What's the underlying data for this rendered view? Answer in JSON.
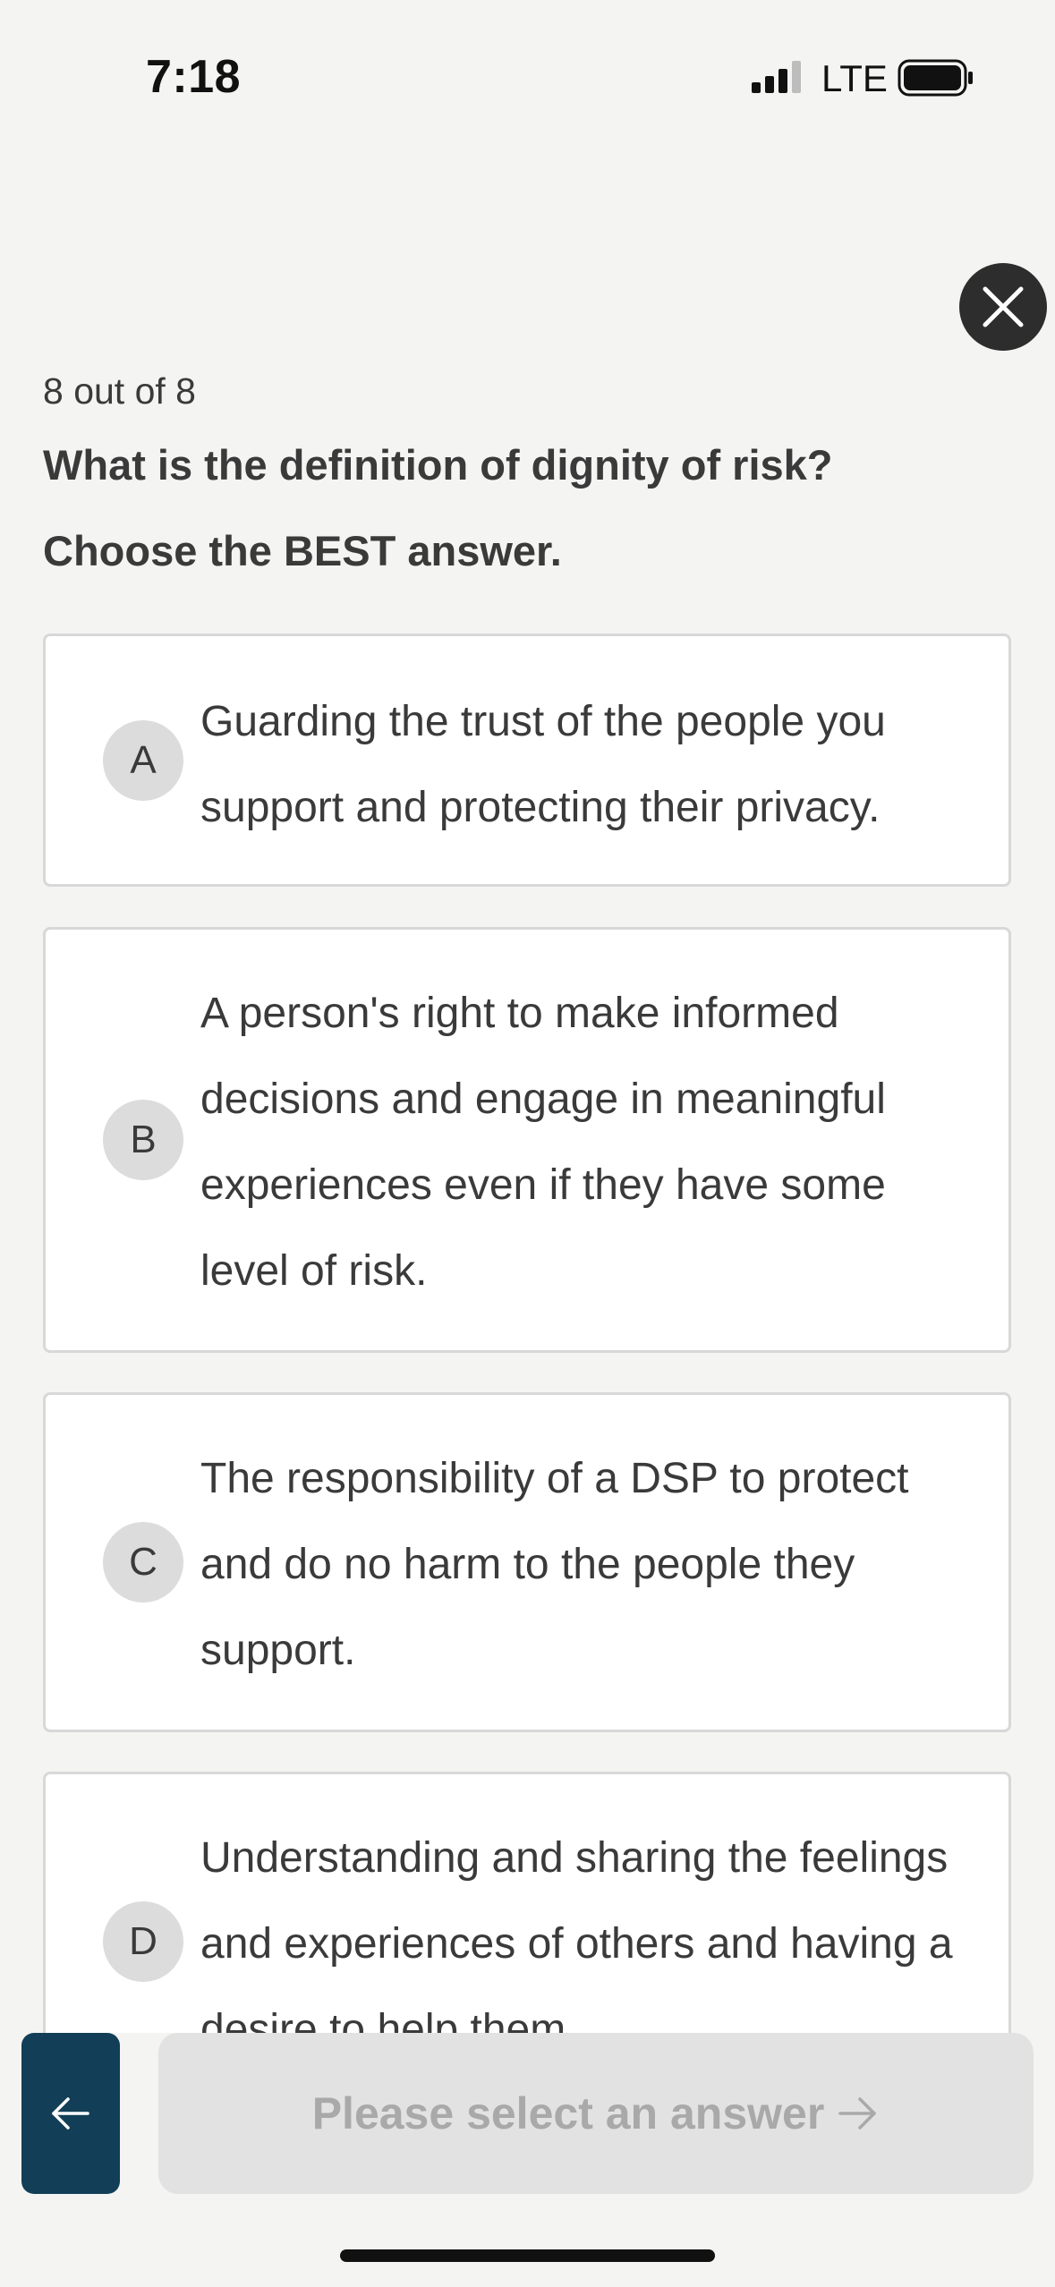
{
  "status_bar": {
    "time": "7:18",
    "network": "LTE"
  },
  "quiz": {
    "progress": "8 out of 8",
    "question": "What is the definition of dignity of risk?",
    "instruction": "Choose the BEST answer."
  },
  "options": [
    {
      "letter": "A",
      "text": "Guarding the trust of the people you support and protecting their privacy."
    },
    {
      "letter": "B",
      "text": "A person's right to make informed decisions and engage in meaningful experiences even if they have some level of risk."
    },
    {
      "letter": "C",
      "text": "The responsibility of a DSP to protect and do no harm to the people they support."
    },
    {
      "letter": "D",
      "text": "Understanding and sharing the feelings and experiences of others and having a desire to help them."
    }
  ],
  "footer": {
    "next_label": "Please select an answer"
  },
  "icons": {
    "close": "close-icon",
    "back": "arrow-left-icon",
    "next": "arrow-right-icon"
  },
  "colors": {
    "background": "#f4f4f3",
    "primary": "#123f57",
    "close_button": "#2d2d2d",
    "disabled_button": "#e2e2e2"
  }
}
